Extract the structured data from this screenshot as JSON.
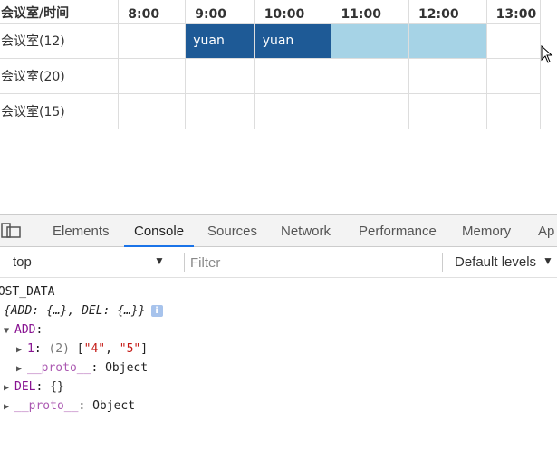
{
  "booking": {
    "header_room": "会议室/时间",
    "times": [
      "8:00",
      "9:00",
      "10:00",
      "11:00",
      "12:00",
      "13:00"
    ],
    "rooms": [
      {
        "name": "会议室(12)",
        "cells": [
          "",
          "yuan",
          "yuan",
          "",
          "",
          ""
        ],
        "states": [
          "empty",
          "booked",
          "booked",
          "selected",
          "selected",
          "empty"
        ]
      },
      {
        "name": "会议室(20)",
        "cells": [
          "",
          "",
          "",
          "",
          "",
          ""
        ],
        "states": [
          "empty",
          "empty",
          "empty",
          "empty",
          "empty",
          "empty"
        ]
      },
      {
        "name": "会议室(15)",
        "cells": [
          "",
          "",
          "",
          "",
          "",
          ""
        ],
        "states": [
          "empty",
          "empty",
          "empty",
          "empty",
          "empty",
          "empty"
        ]
      }
    ]
  },
  "devtools": {
    "tabs": [
      "Elements",
      "Console",
      "Sources",
      "Network",
      "Performance",
      "Memory",
      "Ap"
    ],
    "active_tab": "Console",
    "context": "top",
    "filter_placeholder": "Filter",
    "levels": "Default levels",
    "console": {
      "log_label": "POST_DATA",
      "object_summary": "{ADD: {…}, DEL: {…}}",
      "add_key": "ADD",
      "add_item_key": "1",
      "add_item_count": "(2)",
      "add_item_values": [
        "\"4\"",
        "\"5\""
      ],
      "proto_key": "__proto__",
      "proto_value": "Object",
      "del_key": "DEL",
      "del_value": "{}"
    }
  },
  "colors": {
    "booked": "#1e5a96",
    "selected": "#a6d3e6",
    "active_tab_underline": "#1a73e8"
  }
}
